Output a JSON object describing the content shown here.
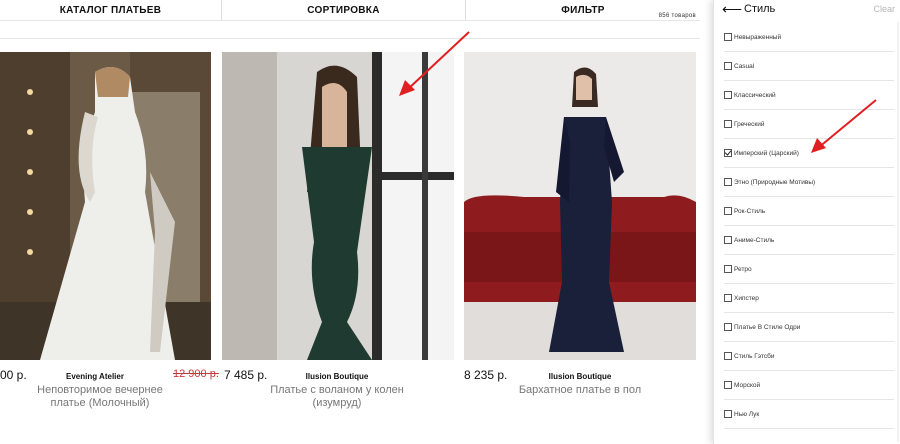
{
  "header": {
    "catalog_label": "КАТАЛОГ ПЛАТЬЕВ",
    "sort_label": "СОРТИРОВКА",
    "filter_label": "ФИЛЬТР",
    "items_count": "856 товаров"
  },
  "products": [
    {
      "price": "00 р.",
      "old_price": "12 900 р.",
      "brand": "Evening Atelier",
      "name_line1": "Неповторимое вечернее",
      "name_line2": "платье (Молочный)"
    },
    {
      "price": "7 485 р.",
      "brand": "Ilusion Boutique",
      "name_line1": "Платье с воланом у колен",
      "name_line2": "(изумруд)"
    },
    {
      "price": "8 235 р.",
      "brand": "Ilusion Boutique",
      "name_line1": "Бархатное платье в пол",
      "name_line2": ""
    }
  ],
  "filter_panel": {
    "title": "Стиль",
    "clear_label": "Clear",
    "options": [
      {
        "label": "Невыраженный",
        "checked": false
      },
      {
        "label": "Casual",
        "checked": false
      },
      {
        "label": "Классический",
        "checked": false
      },
      {
        "label": "Греческий",
        "checked": false
      },
      {
        "label": "Имперский (Царский)",
        "checked": true
      },
      {
        "label": "Этно (Природные Мотивы)",
        "checked": false
      },
      {
        "label": "Рок-Стиль",
        "checked": false
      },
      {
        "label": "Аниме-Стиль",
        "checked": false
      },
      {
        "label": "Ретро",
        "checked": false
      },
      {
        "label": "Хипстер",
        "checked": false
      },
      {
        "label": "Платье В Стиле Одри",
        "checked": false
      },
      {
        "label": "Стиль Гэтсби",
        "checked": false
      },
      {
        "label": "Морской",
        "checked": false
      },
      {
        "label": "Нью Лук",
        "checked": false
      }
    ]
  },
  "colors": {
    "arrow": "#e02020",
    "old_price": "#c63b3b",
    "clear": "#b5b5b5"
  }
}
